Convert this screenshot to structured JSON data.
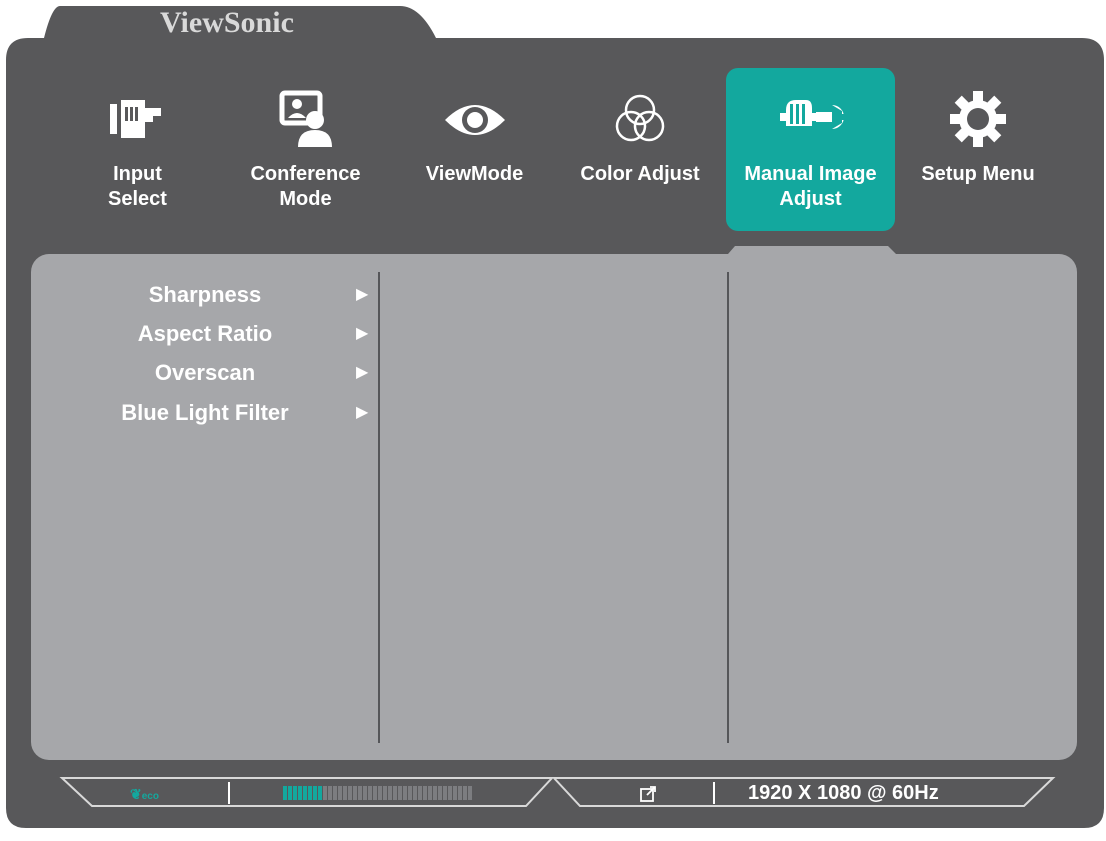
{
  "brand": "ViewSonic",
  "tabs": [
    {
      "label": "Input\nSelect",
      "icon": "input-select-icon",
      "active": false
    },
    {
      "label": "Conference\nMode",
      "icon": "conference-mode-icon",
      "active": false
    },
    {
      "label": "ViewMode",
      "icon": "eye-icon",
      "active": false
    },
    {
      "label": "Color Adjust",
      "icon": "color-adjust-icon",
      "active": false
    },
    {
      "label": "Manual Image\nAdjust",
      "icon": "manual-image-adjust-icon",
      "active": true
    },
    {
      "label": "Setup Menu",
      "icon": "gear-icon",
      "active": false
    }
  ],
  "menu": {
    "items": [
      {
        "label": "Sharpness"
      },
      {
        "label": "Aspect Ratio"
      },
      {
        "label": "Overscan"
      },
      {
        "label": "Blue Light Filter"
      }
    ],
    "arrow": "▶"
  },
  "status": {
    "eco_label": "eco",
    "brightness_fraction": 0.2,
    "resolution": "1920 X 1080 @ 60Hz",
    "separator": "|"
  },
  "colors": {
    "accent": "#13a89e",
    "frame": "#58585a",
    "panel": "#a6a7aa"
  }
}
